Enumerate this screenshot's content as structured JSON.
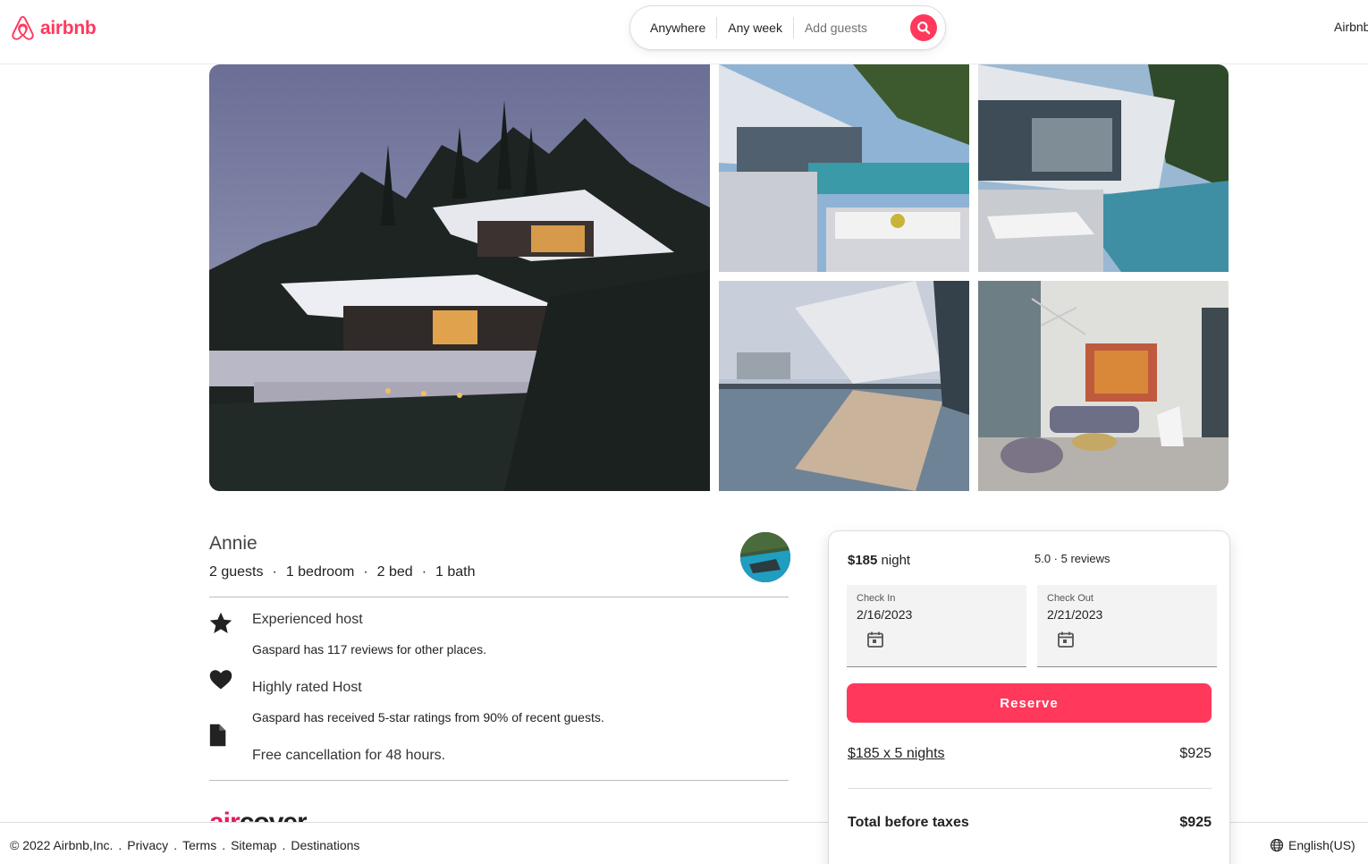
{
  "header": {
    "logo_text": "airbnb",
    "search": {
      "location": "Anywhere",
      "dates": "Any week",
      "guests": "Add guests"
    },
    "right_link": "Airbnb"
  },
  "gallery": {
    "photos": [
      "villa-exterior-dusk",
      "terrace-pool",
      "pool-lounge",
      "infinity-pool-reflection",
      "living-room"
    ]
  },
  "listing": {
    "host_name": "Annie",
    "details": [
      "2 guests",
      "1 bedroom",
      "2 bed",
      "1 bath"
    ],
    "features": [
      {
        "icon": "star-icon",
        "title": "Experienced host",
        "desc": "Gaspard has 117 reviews for other places."
      },
      {
        "icon": "heart-icon",
        "title": "Highly rated Host",
        "desc": "Gaspard has received 5-star ratings from 90% of recent guests."
      },
      {
        "icon": "document-icon",
        "title": "Free cancellation for 48 hours.",
        "desc": ""
      }
    ],
    "aircover_air": "air",
    "aircover_cover": "cover"
  },
  "booking": {
    "price": "$185",
    "price_unit": "night",
    "rating": "5.0 · 5 reviews",
    "check_in_label": "Check In",
    "check_in_value": "2/16/2023",
    "check_out_label": "Check Out",
    "check_out_value": "2/21/2023",
    "reserve_label": "Reserve",
    "calc_label": "$185 x 5 nights",
    "calc_value": "$925",
    "total_label": "Total before taxes",
    "total_value": "$925"
  },
  "footer": {
    "links": [
      "© 2022 Airbnb,Inc.",
      "Privacy",
      "Terms",
      "Sitemap",
      "Destinations"
    ],
    "language": "English(US)"
  },
  "colors": {
    "brand": "#ff385c",
    "text": "#222222",
    "muted": "#717171",
    "border": "#dddddd"
  }
}
